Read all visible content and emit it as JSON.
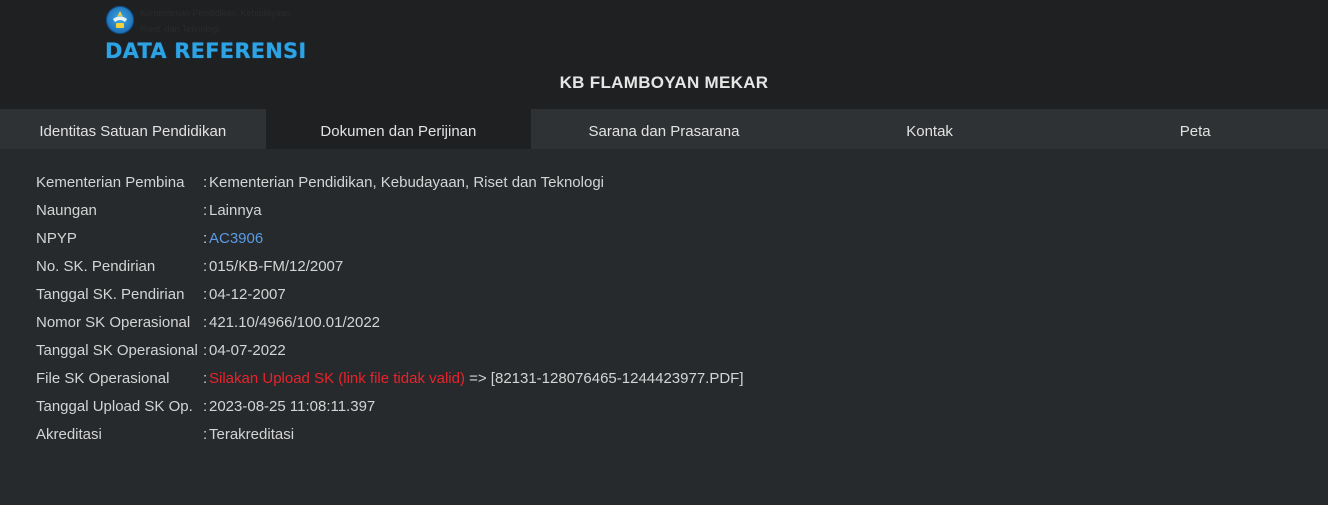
{
  "header": {
    "ministry_line1": "Kementerian Pendidikan, Kebudayaan,",
    "ministry_line2": "Riset, dan Teknologi",
    "brand": "DATA REFERENSI",
    "logo_icon": "tut-wuri-handayani-emblem",
    "brand_color": "#2ea3e3"
  },
  "school_name": "KB FLAMBOYAN MEKAR",
  "tabs": [
    {
      "label": "Identitas Satuan Pendidikan",
      "active": false
    },
    {
      "label": "Dokumen dan Perijinan",
      "active": true
    },
    {
      "label": "Sarana dan Prasarana",
      "active": false
    },
    {
      "label": "Kontak",
      "active": false
    },
    {
      "label": "Peta",
      "active": false
    }
  ],
  "separator": ":",
  "fields": [
    {
      "label": "Kementerian Pembina",
      "value": "Kementerian Pendidikan, Kebudayaan, Riset dan Teknologi"
    },
    {
      "label": "Naungan",
      "value": "Lainnya"
    },
    {
      "label": "NPYP",
      "value": "AC3906"
    },
    {
      "label": "No. SK. Pendirian",
      "value": "015/KB-FM/12/2007"
    },
    {
      "label": "Tanggal SK. Pendirian",
      "value": "04-12-2007"
    },
    {
      "label": "Nomor SK Operasional",
      "value": "421.10/4966/100.01/2022"
    },
    {
      "label": "Tanggal SK Operasional",
      "value": "04-07-2022"
    },
    {
      "label": "File SK Operasional",
      "value_warning": "Silakan Upload SK (link file tidak valid)",
      "value_suffix": " => [82131-128076465-1244423977.PDF]"
    },
    {
      "label": "Tanggal Upload SK Op.",
      "value": "2023-08-25 11:08:11.397"
    },
    {
      "label": "Akreditasi",
      "value": "Terakreditasi"
    }
  ],
  "colors": {
    "background": "#1e2022",
    "tabbar": "#2f3234",
    "content": "#262a2c",
    "link": "#5b9be4",
    "warning": "#e8232b"
  }
}
